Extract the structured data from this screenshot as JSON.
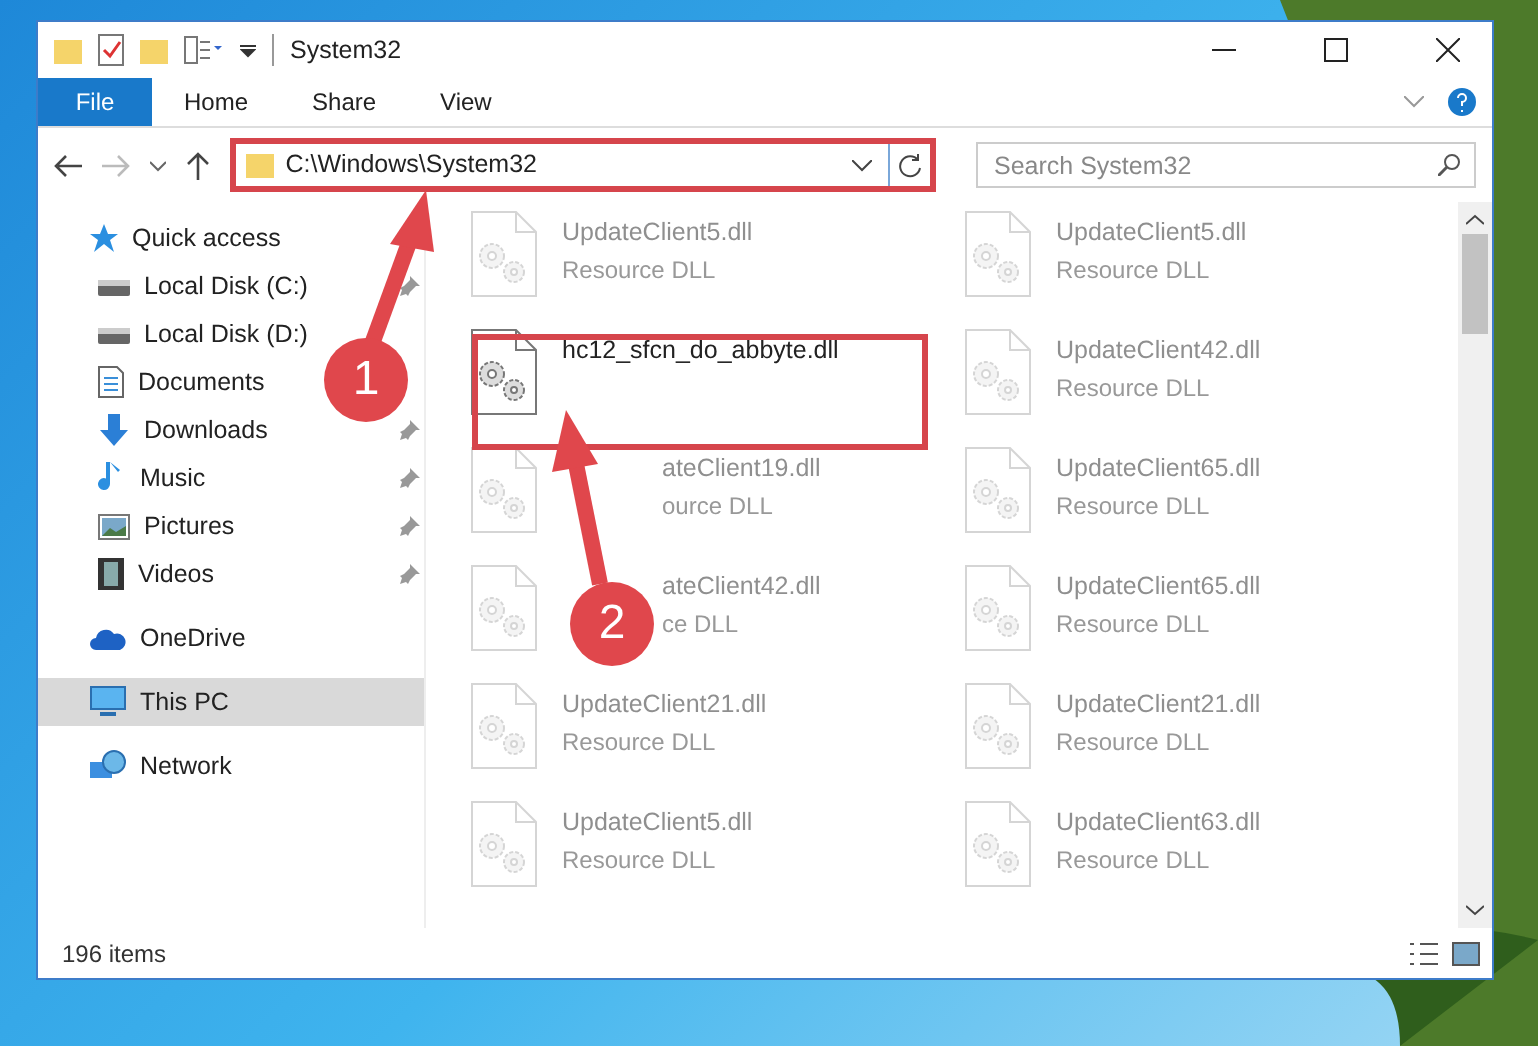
{
  "window": {
    "title": "System32"
  },
  "ribbon": {
    "tabs": [
      {
        "label": "File",
        "kind": "file",
        "selected": false
      },
      {
        "label": "Home",
        "kind": "tab",
        "selected": false
      },
      {
        "label": "Share",
        "kind": "tab",
        "selected": false
      },
      {
        "label": "View",
        "kind": "tab",
        "selected": false
      }
    ]
  },
  "address_bar": {
    "path": "C:\\Windows\\System32"
  },
  "search": {
    "placeholder": "Search System32"
  },
  "sidebar": {
    "items": [
      {
        "label": "Quick access",
        "selected": false,
        "children": [
          {
            "label": "Local Disk (C:)",
            "pinned": true
          },
          {
            "label": "Local Disk (D:)",
            "pinned": false
          },
          {
            "label": "Documents",
            "pinned": false
          },
          {
            "label": "Downloads",
            "pinned": true
          },
          {
            "label": "Music",
            "pinned": true
          },
          {
            "label": "Pictures",
            "pinned": true
          },
          {
            "label": "Videos",
            "pinned": true
          }
        ]
      },
      {
        "label": "OneDrive",
        "selected": false
      },
      {
        "label": "This PC",
        "selected": true
      },
      {
        "label": "Network",
        "selected": false
      }
    ]
  },
  "files": [
    {
      "name": "UpdateClient5.dll",
      "type": "Resource DLL",
      "kind": "faded"
    },
    {
      "name": "UpdateClient5.dll",
      "type": "Resource DLL",
      "kind": "faded"
    },
    {
      "name": "hc12_sfcn_do_abbyte.dll",
      "kind": "focus"
    },
    {
      "name": "UpdateClient42.dll",
      "type": "Resource DLL",
      "kind": "faded"
    },
    {
      "name": "ateClient19.dll",
      "type": "ource DLL",
      "kind": "covered"
    },
    {
      "name": "UpdateClient65.dll",
      "type": "Resource DLL",
      "kind": "faded"
    },
    {
      "name": "ateClient42.dll",
      "type": "ce DLL",
      "kind": "covered"
    },
    {
      "name": "UpdateClient65.dll",
      "type": "Resource DLL",
      "kind": "faded"
    },
    {
      "name": "UpdateClient21.dll",
      "type": "Resource DLL",
      "kind": "faded"
    },
    {
      "name": "UpdateClient21.dll",
      "type": "Resource DLL",
      "kind": "faded"
    },
    {
      "name": "UpdateClient5.dll",
      "type": "Resource DLL",
      "kind": "faded"
    },
    {
      "name": "UpdateClient63.dll",
      "type": "Resource DLL",
      "kind": "faded"
    }
  ],
  "status_bar": {
    "count": "196 items"
  },
  "annotations": [
    {
      "label": "1"
    },
    {
      "label": "2"
    }
  ]
}
